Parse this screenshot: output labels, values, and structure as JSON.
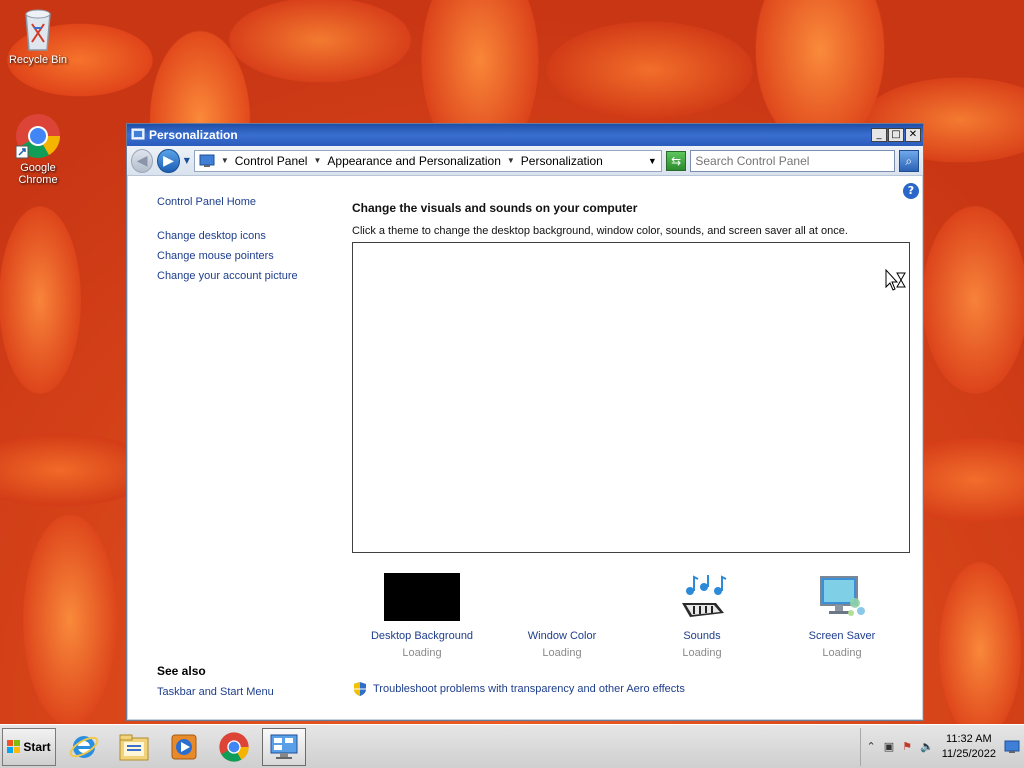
{
  "desktop": {
    "icons": [
      {
        "label": "Recycle Bin",
        "icon": "recycle-bin-icon"
      },
      {
        "label": "Google Chrome",
        "icon": "chrome-icon"
      }
    ]
  },
  "window": {
    "title": "Personalization",
    "controls": {
      "minimize": "_",
      "maximize": "□",
      "close": "✕"
    },
    "breadcrumb": [
      "Control Panel",
      "Appearance and Personalization",
      "Personalization"
    ],
    "search_placeholder": "Search Control Panel",
    "left_nav": {
      "home": "Control Panel Home",
      "tasks": [
        "Change desktop icons",
        "Change mouse pointers",
        "Change your account picture"
      ]
    },
    "see_also": {
      "heading": "See also",
      "links": [
        "Taskbar and Start Menu"
      ]
    },
    "main": {
      "heading": "Change the visuals and sounds on your computer",
      "subheading": "Click a theme to change the desktop background, window color, sounds, and screen saver all at once.",
      "tiles": [
        {
          "label": "Desktop Background",
          "status": "Loading"
        },
        {
          "label": "Window Color",
          "status": "Loading"
        },
        {
          "label": "Sounds",
          "status": "Loading"
        },
        {
          "label": "Screen Saver",
          "status": "Loading"
        }
      ],
      "aero_link": "Troubleshoot problems with transparency and other Aero effects"
    }
  },
  "taskbar": {
    "start_label": "Start",
    "apps": [
      "internet-explorer-icon",
      "windows-explorer-icon",
      "media-player-icon",
      "chrome-icon",
      "control-panel-icon"
    ],
    "clock": {
      "time": "11:32 AM",
      "date": "11/25/2022"
    }
  },
  "colors": {
    "link": "#1e3e8c",
    "titlebar": "#2a5bbd",
    "wallpaper": "#e8421a"
  }
}
